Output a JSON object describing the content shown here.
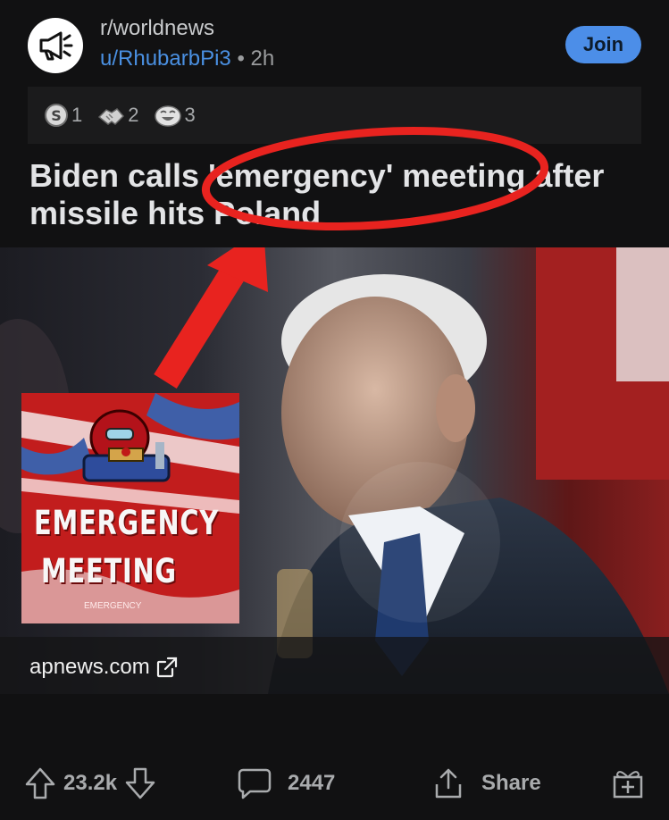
{
  "header": {
    "subreddit": "r/worldnews",
    "author": "u/RhubarbPi3",
    "separator": "•",
    "time_ago": "2h",
    "join_label": "Join"
  },
  "awards": [
    {
      "icon": "silver-award-icon",
      "count": "1"
    },
    {
      "icon": "handshake-award-icon",
      "count": "2"
    },
    {
      "icon": "laughing-award-icon",
      "count": "3"
    }
  ],
  "post": {
    "title": "Biden calls 'emergency' meeting after missile hits Poland",
    "link_domain": "apnews.com"
  },
  "meme": {
    "line1": "EMERGENCY",
    "line2": "MEETING",
    "small": "EMERGENCY"
  },
  "actions": {
    "votes": "23.2k",
    "comments": "2447",
    "share_label": "Share"
  },
  "colors": {
    "accent": "#4c8ee8",
    "annotation_red": "#e8231f",
    "background": "#111112"
  }
}
